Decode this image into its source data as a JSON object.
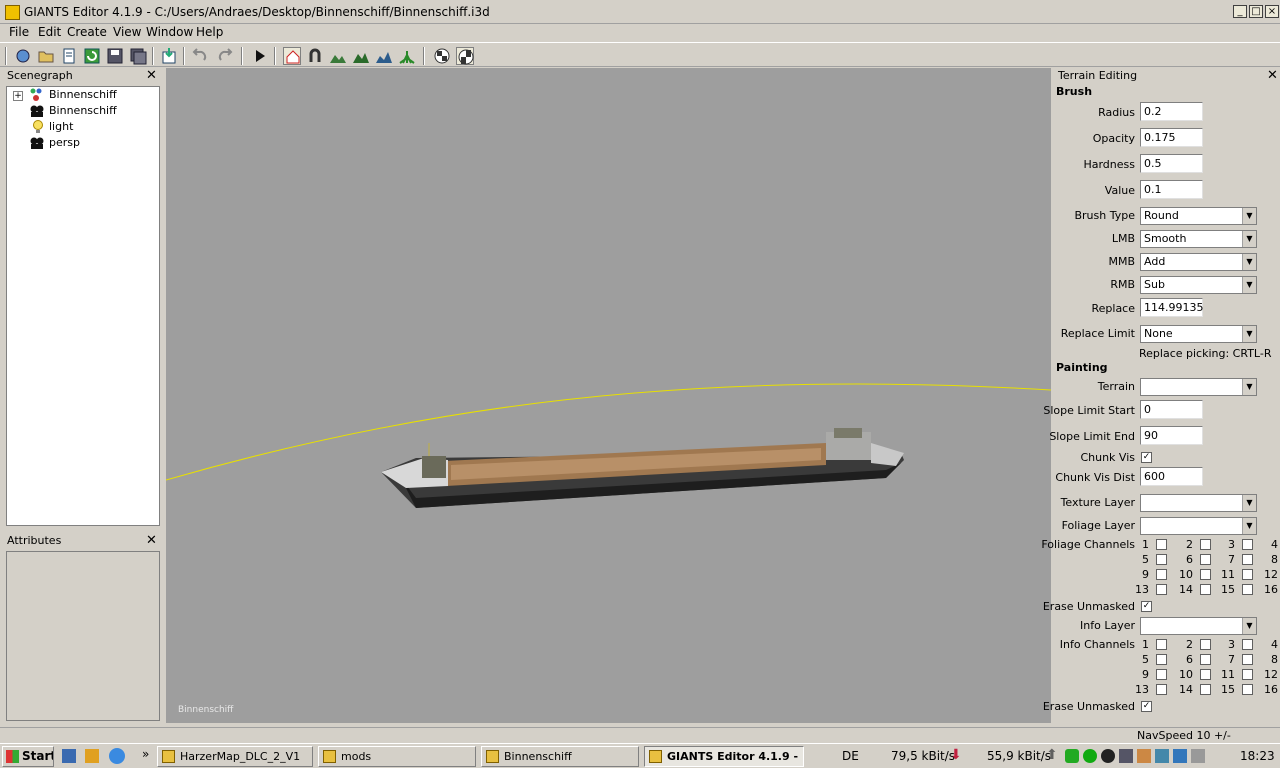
{
  "window": {
    "title": "GIANTS Editor 4.1.9 - C:/Users/Andraes/Desktop/Binnenschiff/Binnenschiff.i3d"
  },
  "menu": [
    "File",
    "Edit",
    "Create",
    "View",
    "Window",
    "Help"
  ],
  "scenegraph": {
    "title": "Scenegraph",
    "items": [
      {
        "label": "Binnenschiff",
        "icon": "transform-group-icon"
      },
      {
        "label": "Binnenschiff",
        "icon": "shape-icon"
      },
      {
        "label": "light",
        "icon": "light-bulb-icon"
      },
      {
        "label": "persp",
        "icon": "camera-icon"
      }
    ]
  },
  "attributes": {
    "title": "Attributes"
  },
  "viewport": {
    "label": "Binnenschiff"
  },
  "terrain": {
    "title": "Terrain Editing",
    "brush_header": "Brush",
    "radius_label": "Radius",
    "radius": "0.2",
    "opacity_label": "Opacity",
    "opacity": "0.175",
    "hardness_label": "Hardness",
    "hardness": "0.5",
    "value_label": "Value",
    "value": "0.1",
    "brush_type_label": "Brush Type",
    "brush_type": "Round",
    "lmb_label": "LMB",
    "lmb": "Smooth",
    "mmb_label": "MMB",
    "mmb": "Add",
    "rmb_label": "RMB",
    "rmb": "Sub",
    "replace_label": "Replace",
    "replace": "114.99135",
    "replace_limit_label": "Replace Limit",
    "replace_limit": "None",
    "replace_picking": "Replace picking: CRTL-R",
    "painting_header": "Painting",
    "terrain_label": "Terrain",
    "terrain": "",
    "slope_start_label": "Slope Limit Start",
    "slope_start": "0",
    "slope_end_label": "Slope Limit End",
    "slope_end": "90",
    "chunk_vis_label": "Chunk Vis",
    "chunk_vis_dist_label": "Chunk Vis Dist",
    "chunk_vis_dist": "600",
    "texture_layer_label": "Texture Layer",
    "foliage_layer_label": "Foliage Layer",
    "foliage_channels_label": "Foliage Channels",
    "erase_unmasked_label": "Erase Unmasked",
    "info_layer_label": "Info Layer",
    "info_channels_label": "Info Channels",
    "erase_unmasked2_label": "Erase Unmasked",
    "channels": [
      "1",
      "2",
      "3",
      "4",
      "5",
      "6",
      "7",
      "8",
      "9",
      "10",
      "11",
      "12",
      "13",
      "14",
      "15",
      "16"
    ]
  },
  "status": {
    "navspeed": "NavSpeed 10 +/-"
  },
  "taskbar": {
    "start": "Start",
    "tasks": [
      "HarzerMap_DLC_2_V1",
      "mods",
      "Binnenschiff",
      "GIANTS Editor 4.1.9 - ..."
    ],
    "lang": "DE",
    "down_rate": "79,5 kBit/s",
    "up_rate": "55,9 kBit/s",
    "clock": "18:23"
  }
}
